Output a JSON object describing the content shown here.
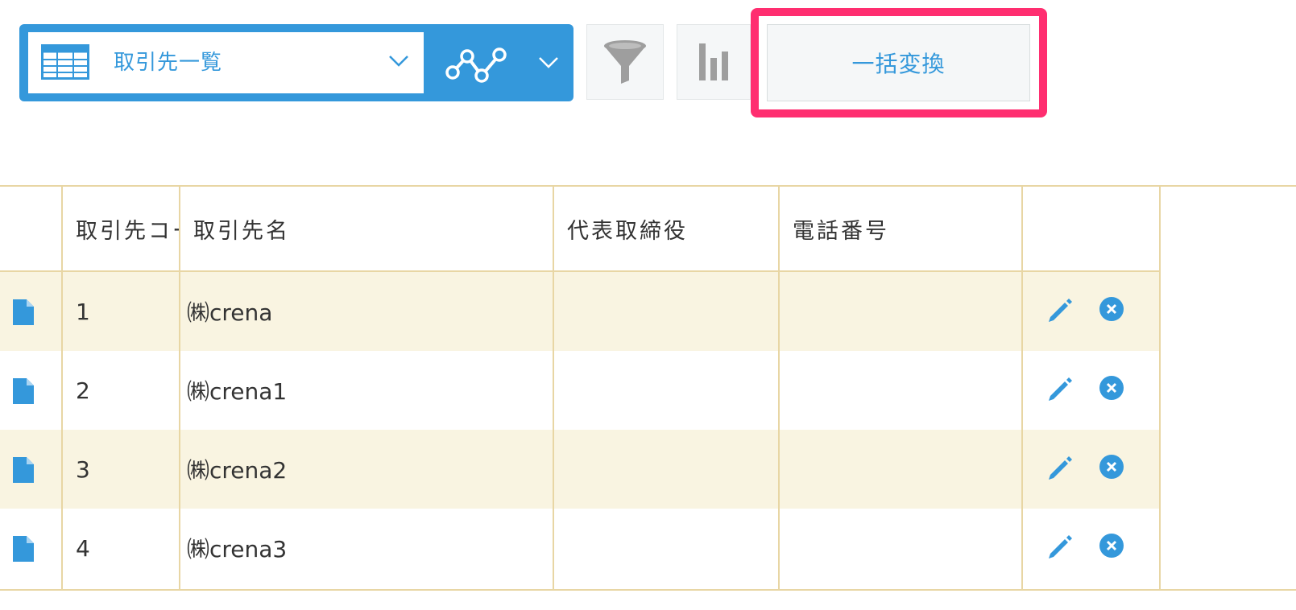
{
  "toolbar": {
    "view_name": "取引先一覧",
    "bulk_convert_label": "一括変換",
    "accent_color": "#3498db",
    "highlight_color": "#ff2e70"
  },
  "table": {
    "columns": [
      "",
      "取引先コード",
      "取引先名",
      "代表取締役",
      "電話番号",
      ""
    ],
    "rows": [
      {
        "code": "1",
        "name": "㈱crena",
        "representative": "",
        "phone": ""
      },
      {
        "code": "2",
        "name": "㈱crena1",
        "representative": "",
        "phone": ""
      },
      {
        "code": "3",
        "name": "㈱crena2",
        "representative": "",
        "phone": ""
      },
      {
        "code": "4",
        "name": "㈱crena3",
        "representative": "",
        "phone": ""
      }
    ]
  },
  "icons": {
    "view": "table-icon",
    "graph_menu": "line-graph-icon",
    "filter": "funnel-icon",
    "graph": "bar-chart-icon",
    "record": "document-icon",
    "edit": "pencil-icon",
    "delete": "close-circle-icon"
  }
}
